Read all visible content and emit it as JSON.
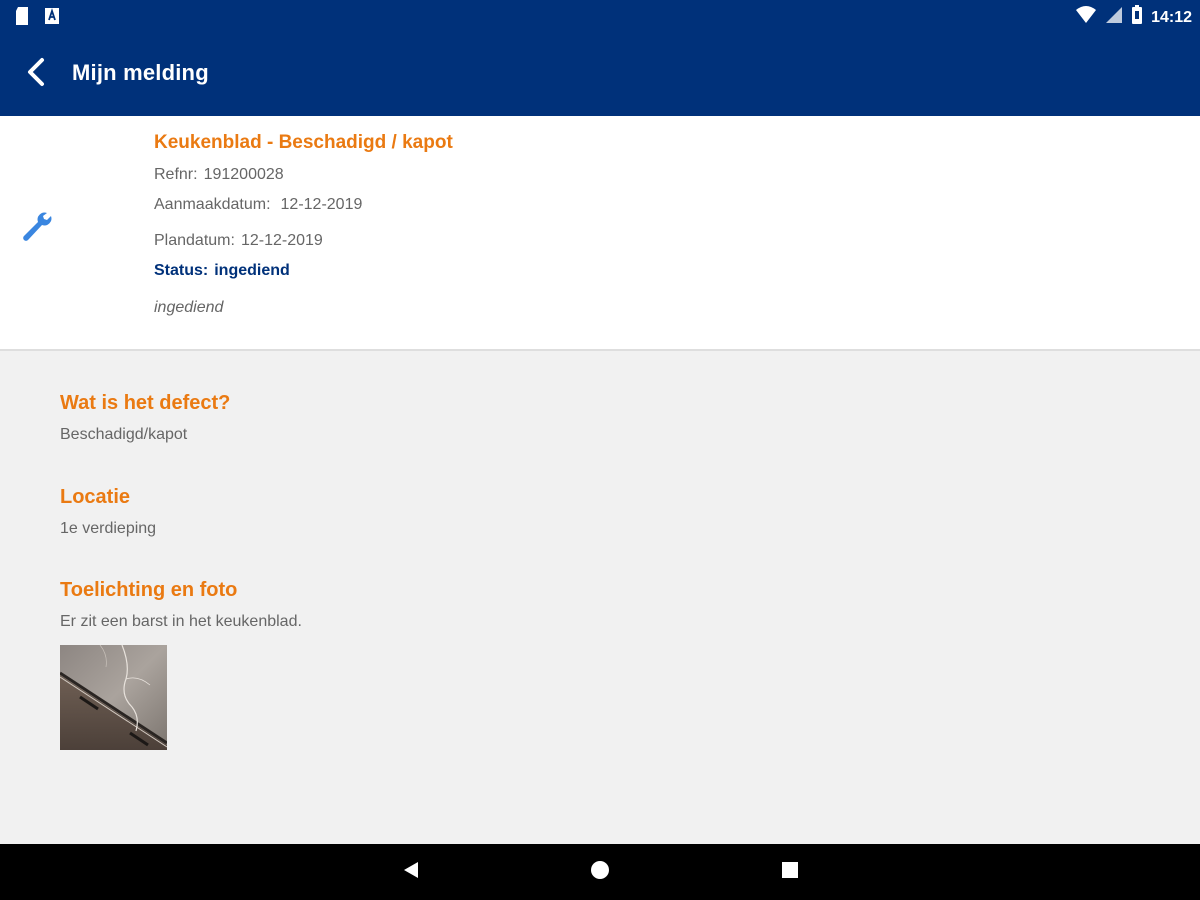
{
  "status_bar": {
    "time": "14:12",
    "left_icons": [
      "sd-card-icon",
      "app-notification-icon"
    ],
    "right_icons": [
      "wifi-icon",
      "signal-icon",
      "battery-icon"
    ]
  },
  "app_bar": {
    "title": "Mijn melding",
    "back_icon": "chevron-left-icon",
    "background": "#00317a"
  },
  "melding": {
    "icon": "wrench-icon",
    "title": "Keukenblad - Beschadigd / kapot",
    "refnr_label": "Refnr:",
    "refnr_value": "191200028",
    "aanmaakdatum_label": "Aanmaakdatum:",
    "aanmaakdatum_value": "12-12-2019",
    "plandatum_label": "Plandatum:",
    "plandatum_value": "12-12-2019",
    "status_label": "Status:",
    "status_value": "ingediend",
    "status_note": "ingediend"
  },
  "details": [
    {
      "heading": "Wat is het defect?",
      "text": "Beschadigd/kapot"
    },
    {
      "heading": "Locatie",
      "text": "1e verdieping"
    },
    {
      "heading": "Toelichting en foto",
      "text": "Er zit een barst in het keukenblad."
    }
  ],
  "nav_bar": {
    "icons": [
      "back-triangle-icon",
      "home-circle-icon",
      "recents-square-icon"
    ]
  },
  "colors": {
    "accent": "#ea7a12",
    "primary": "#00317a",
    "background": "#f1f1f1"
  }
}
